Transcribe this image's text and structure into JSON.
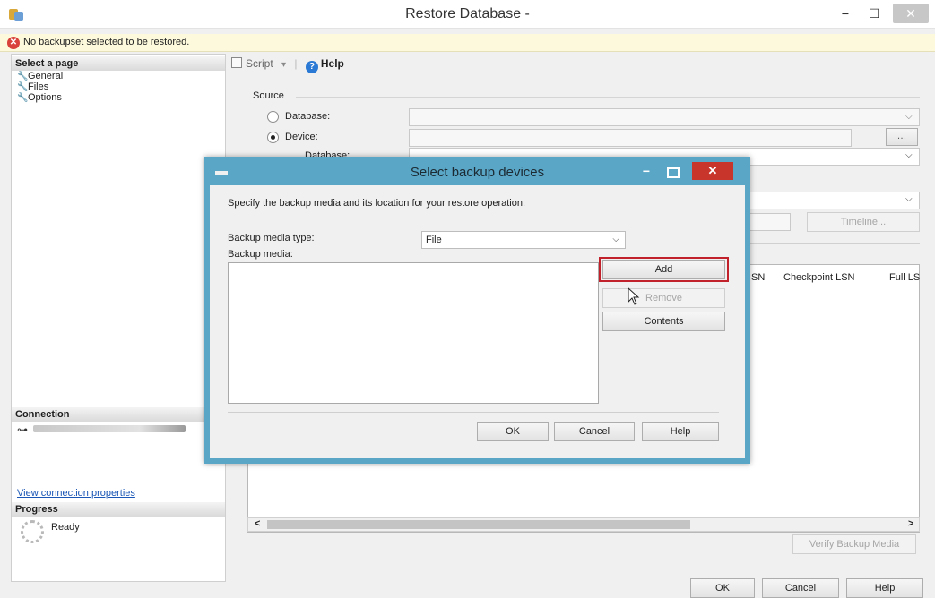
{
  "window": {
    "title": "Restore Database -"
  },
  "banner": {
    "message": "No backupset selected to be restored."
  },
  "left_pane": {
    "select_page_header": "Select a page",
    "pages": [
      "General",
      "Files",
      "Options"
    ],
    "connection_header": "Connection",
    "view_connection_link": "View connection properties",
    "progress_header": "Progress",
    "progress_status": "Ready"
  },
  "toolbar": {
    "script_label": "Script",
    "help_label": "Help"
  },
  "source": {
    "label": "Source",
    "database_option": "Database:",
    "device_option": "Device:",
    "database_label": "Database:",
    "selected": "Device"
  },
  "main": {
    "timeline_button": "Timeline...",
    "grid_columns": [
      "SN",
      "Checkpoint LSN",
      "Full LS"
    ],
    "verify_button": "Verify Backup Media",
    "ok_button": "OK",
    "cancel_button": "Cancel",
    "help_button": "Help"
  },
  "dialog": {
    "title": "Select backup devices",
    "instruction": "Specify the backup media and its location for your restore operation.",
    "media_type_label": "Backup media type:",
    "media_type_value": "File",
    "media_label": "Backup media:",
    "add_button": "Add",
    "remove_button": "Remove",
    "contents_button": "Contents",
    "ok_button": "OK",
    "cancel_button": "Cancel",
    "help_button": "Help"
  },
  "colors": {
    "dialog_border": "#5aa6c7",
    "close_button": "#c7352b",
    "highlight": "#c1212a",
    "banner_bg": "#fdf9dc",
    "link": "#1a56b5"
  }
}
